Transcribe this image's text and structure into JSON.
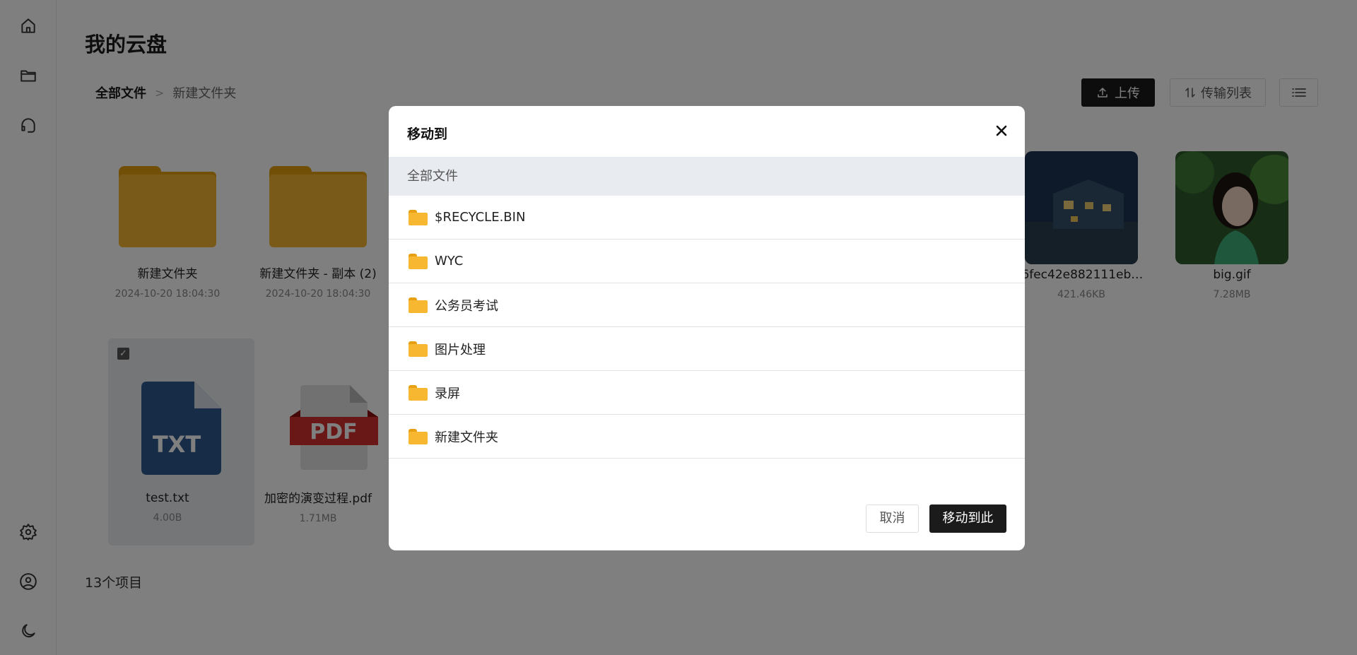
{
  "page": {
    "title": "我的云盘"
  },
  "breadcrumb": {
    "root": "全部文件",
    "separator": ">",
    "current": "新建文件夹"
  },
  "toolbar": {
    "upload_label": "上传",
    "transfer_label": "传输列表"
  },
  "tiles": [
    {
      "kind": "folder",
      "name": "新建文件夹",
      "meta": "2024-10-20 18:04:30"
    },
    {
      "kind": "folder",
      "name": "新建文件夹 - 副本 (2)",
      "meta": "2024-10-20 18:04:30"
    },
    {
      "kind": "image",
      "name": "a6fec42e882111ebb…",
      "meta": "421.46KB"
    },
    {
      "kind": "image",
      "name": "big.gif",
      "meta": "7.28MB"
    },
    {
      "kind": "txt",
      "name": "test.txt",
      "meta": "4.00B",
      "badge": "TXT",
      "selected": true
    },
    {
      "kind": "pdf",
      "name": "加密的演变过程.pdf",
      "meta": "1.71MB",
      "badge": "PDF"
    }
  ],
  "count_label": "13个项目",
  "modal": {
    "title": "移动到",
    "crumb": "全部文件",
    "folders": [
      "$RECYCLE.BIN",
      "WYC",
      "公务员考试",
      "图片处理",
      "录屏",
      "新建文件夹"
    ],
    "cancel_label": "取消",
    "confirm_label": "移动到此"
  },
  "colors": {
    "accent": "#1b1b1b",
    "folder": "#f4b530"
  },
  "icons": [
    "home-icon",
    "folder-icon",
    "headset-icon",
    "settings-icon",
    "user-icon",
    "moon-icon",
    "upload-icon",
    "transfer-icon",
    "list-icon",
    "close-icon"
  ]
}
